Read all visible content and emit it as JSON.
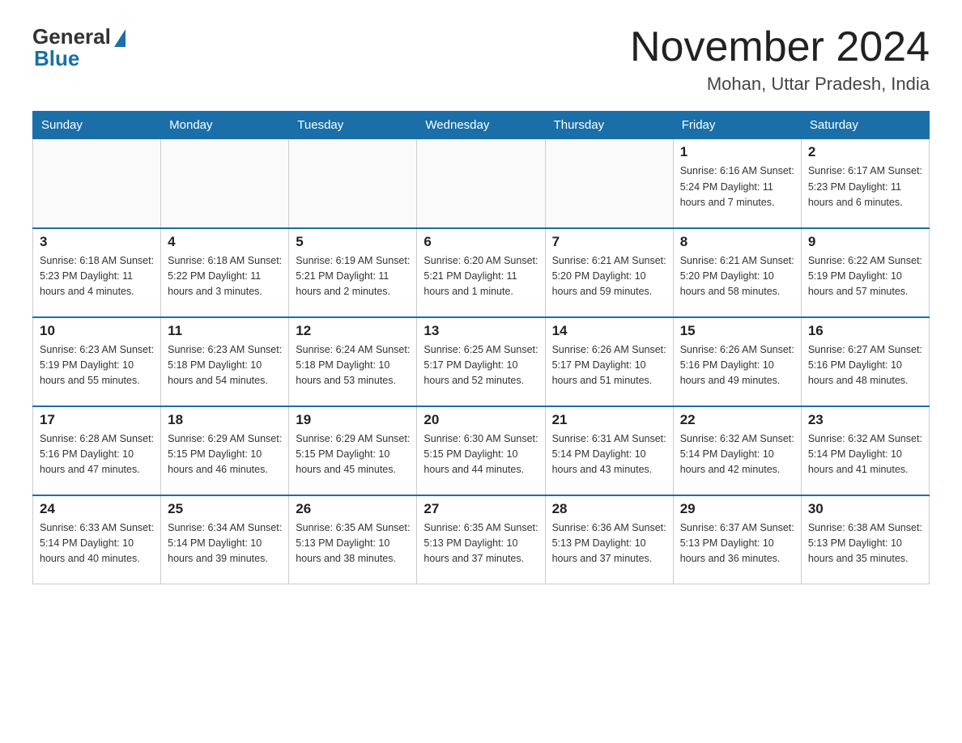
{
  "logo": {
    "text_general": "General",
    "text_blue": "Blue"
  },
  "title": {
    "month": "November 2024",
    "location": "Mohan, Uttar Pradesh, India"
  },
  "weekdays": [
    "Sunday",
    "Monday",
    "Tuesday",
    "Wednesday",
    "Thursday",
    "Friday",
    "Saturday"
  ],
  "weeks": [
    [
      {
        "day": "",
        "info": ""
      },
      {
        "day": "",
        "info": ""
      },
      {
        "day": "",
        "info": ""
      },
      {
        "day": "",
        "info": ""
      },
      {
        "day": "",
        "info": ""
      },
      {
        "day": "1",
        "info": "Sunrise: 6:16 AM\nSunset: 5:24 PM\nDaylight: 11 hours and 7 minutes."
      },
      {
        "day": "2",
        "info": "Sunrise: 6:17 AM\nSunset: 5:23 PM\nDaylight: 11 hours and 6 minutes."
      }
    ],
    [
      {
        "day": "3",
        "info": "Sunrise: 6:18 AM\nSunset: 5:23 PM\nDaylight: 11 hours and 4 minutes."
      },
      {
        "day": "4",
        "info": "Sunrise: 6:18 AM\nSunset: 5:22 PM\nDaylight: 11 hours and 3 minutes."
      },
      {
        "day": "5",
        "info": "Sunrise: 6:19 AM\nSunset: 5:21 PM\nDaylight: 11 hours and 2 minutes."
      },
      {
        "day": "6",
        "info": "Sunrise: 6:20 AM\nSunset: 5:21 PM\nDaylight: 11 hours and 1 minute."
      },
      {
        "day": "7",
        "info": "Sunrise: 6:21 AM\nSunset: 5:20 PM\nDaylight: 10 hours and 59 minutes."
      },
      {
        "day": "8",
        "info": "Sunrise: 6:21 AM\nSunset: 5:20 PM\nDaylight: 10 hours and 58 minutes."
      },
      {
        "day": "9",
        "info": "Sunrise: 6:22 AM\nSunset: 5:19 PM\nDaylight: 10 hours and 57 minutes."
      }
    ],
    [
      {
        "day": "10",
        "info": "Sunrise: 6:23 AM\nSunset: 5:19 PM\nDaylight: 10 hours and 55 minutes."
      },
      {
        "day": "11",
        "info": "Sunrise: 6:23 AM\nSunset: 5:18 PM\nDaylight: 10 hours and 54 minutes."
      },
      {
        "day": "12",
        "info": "Sunrise: 6:24 AM\nSunset: 5:18 PM\nDaylight: 10 hours and 53 minutes."
      },
      {
        "day": "13",
        "info": "Sunrise: 6:25 AM\nSunset: 5:17 PM\nDaylight: 10 hours and 52 minutes."
      },
      {
        "day": "14",
        "info": "Sunrise: 6:26 AM\nSunset: 5:17 PM\nDaylight: 10 hours and 51 minutes."
      },
      {
        "day": "15",
        "info": "Sunrise: 6:26 AM\nSunset: 5:16 PM\nDaylight: 10 hours and 49 minutes."
      },
      {
        "day": "16",
        "info": "Sunrise: 6:27 AM\nSunset: 5:16 PM\nDaylight: 10 hours and 48 minutes."
      }
    ],
    [
      {
        "day": "17",
        "info": "Sunrise: 6:28 AM\nSunset: 5:16 PM\nDaylight: 10 hours and 47 minutes."
      },
      {
        "day": "18",
        "info": "Sunrise: 6:29 AM\nSunset: 5:15 PM\nDaylight: 10 hours and 46 minutes."
      },
      {
        "day": "19",
        "info": "Sunrise: 6:29 AM\nSunset: 5:15 PM\nDaylight: 10 hours and 45 minutes."
      },
      {
        "day": "20",
        "info": "Sunrise: 6:30 AM\nSunset: 5:15 PM\nDaylight: 10 hours and 44 minutes."
      },
      {
        "day": "21",
        "info": "Sunrise: 6:31 AM\nSunset: 5:14 PM\nDaylight: 10 hours and 43 minutes."
      },
      {
        "day": "22",
        "info": "Sunrise: 6:32 AM\nSunset: 5:14 PM\nDaylight: 10 hours and 42 minutes."
      },
      {
        "day": "23",
        "info": "Sunrise: 6:32 AM\nSunset: 5:14 PM\nDaylight: 10 hours and 41 minutes."
      }
    ],
    [
      {
        "day": "24",
        "info": "Sunrise: 6:33 AM\nSunset: 5:14 PM\nDaylight: 10 hours and 40 minutes."
      },
      {
        "day": "25",
        "info": "Sunrise: 6:34 AM\nSunset: 5:14 PM\nDaylight: 10 hours and 39 minutes."
      },
      {
        "day": "26",
        "info": "Sunrise: 6:35 AM\nSunset: 5:13 PM\nDaylight: 10 hours and 38 minutes."
      },
      {
        "day": "27",
        "info": "Sunrise: 6:35 AM\nSunset: 5:13 PM\nDaylight: 10 hours and 37 minutes."
      },
      {
        "day": "28",
        "info": "Sunrise: 6:36 AM\nSunset: 5:13 PM\nDaylight: 10 hours and 37 minutes."
      },
      {
        "day": "29",
        "info": "Sunrise: 6:37 AM\nSunset: 5:13 PM\nDaylight: 10 hours and 36 minutes."
      },
      {
        "day": "30",
        "info": "Sunrise: 6:38 AM\nSunset: 5:13 PM\nDaylight: 10 hours and 35 minutes."
      }
    ]
  ]
}
